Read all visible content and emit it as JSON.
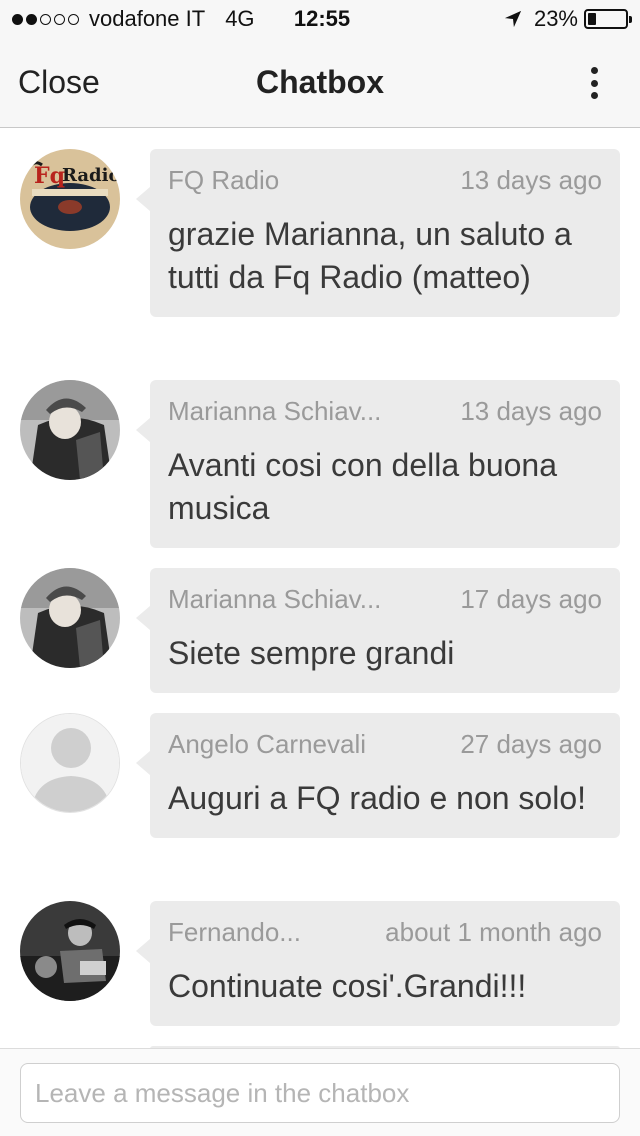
{
  "status_bar": {
    "carrier": "vodafone IT",
    "network": "4G",
    "time": "12:55",
    "battery": "23%",
    "battery_level": 0.23,
    "signal_strength": 2,
    "signal_max": 5
  },
  "nav": {
    "close_label": "Close",
    "title": "Chatbox",
    "menu_icon": "more-vertical-icon"
  },
  "messages": [
    {
      "author": "FQ Radio",
      "time": "13 days ago",
      "text": "grazie Marianna, un saluto a tutti da Fq Radio (matteo)",
      "avatar": "fq-radio-logo"
    },
    {
      "author": "Marianna Schiav...",
      "time": "13 days ago",
      "text": "Avanti cosi con della buona musica",
      "avatar": "child-photo"
    },
    {
      "author": "Marianna Schiav...",
      "time": "17 days ago",
      "text": "Siete sempre grandi",
      "avatar": "child-photo"
    },
    {
      "author": "Angelo Carnevali",
      "time": "27 days ago",
      "text": "Auguri a FQ radio e non solo!",
      "avatar": "default-user"
    },
    {
      "author": "Fernando...",
      "time": "about 1 month ago",
      "text": "Continuate cosi'.Grandi!!!",
      "avatar": "vintage-photo"
    }
  ],
  "input": {
    "placeholder": "Leave a message in the chatbox",
    "value": ""
  },
  "colors": {
    "bubble": "#ebebeb",
    "meta_text": "#9a9a9a",
    "bar_bg": "#f7f7f7"
  }
}
